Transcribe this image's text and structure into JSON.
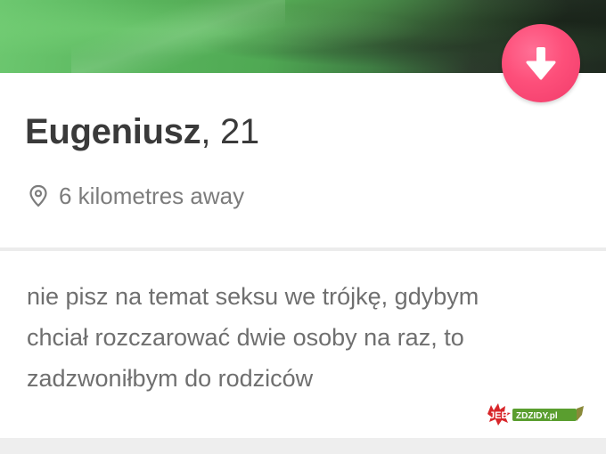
{
  "profile": {
    "name": "Eugeniusz",
    "age": ", 21",
    "distance": "6 kilometres away",
    "bio_lines": [
      "nie pisz na temat seksu we trójkę, gdybym",
      "chciał rozczarować dwie osoby na raz, to",
      "zadzwoniłbym do rodziców"
    ]
  },
  "icons": {
    "collapse": "arrow-down-icon",
    "location": "location-pin-icon"
  },
  "watermark": {
    "text_left": "JEB",
    "text_right": "ZDZIDY.pl"
  },
  "colors": {
    "accent": "#f8456f",
    "name_text": "#3a3a3a",
    "secondary_text": "#7c7c7c"
  }
}
